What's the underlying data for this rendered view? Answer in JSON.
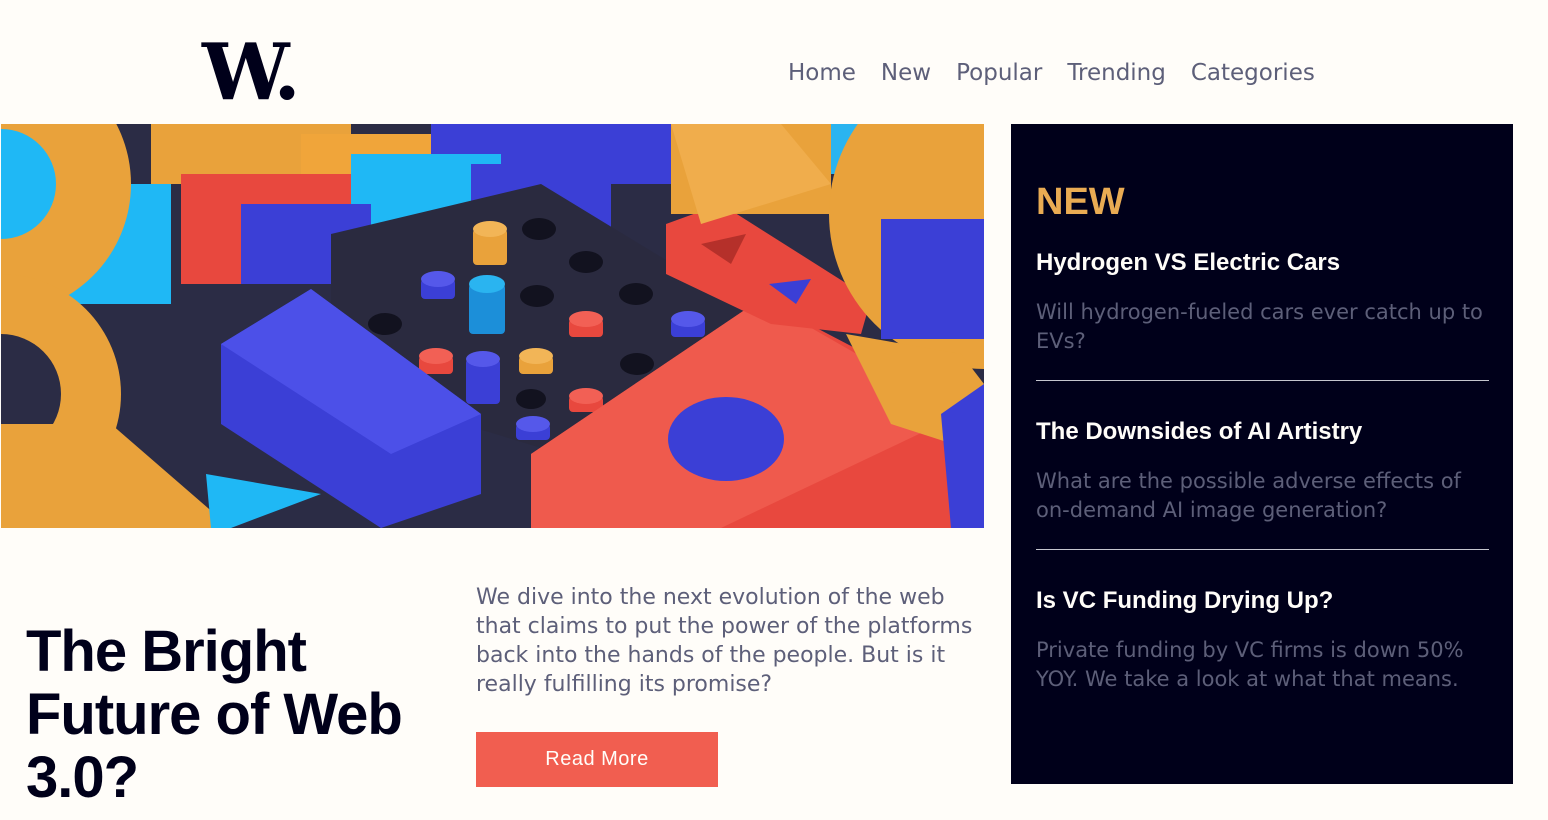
{
  "brand": {
    "logo_text": "W."
  },
  "nav": {
    "items": [
      "Home",
      "New",
      "Popular",
      "Trending",
      "Categories"
    ]
  },
  "hero": {
    "image_alt": "hero-illustration",
    "headline": "The Bright Future of Web 3.0?",
    "description": "We dive into the next evolution of the web that claims to put the power of the platforms back into the hands of the people. But is it really fulfilling its promise?",
    "cta_label": "Read More"
  },
  "new_panel": {
    "heading": "NEW",
    "items": [
      {
        "title": "Hydrogen VS Electric Cars",
        "summary": "Will hydrogen-fueled cars ever catch up to EVs?"
      },
      {
        "title": "The Downsides of AI Artistry",
        "summary": "What are the possible adverse effects of on-demand AI image generation?"
      },
      {
        "title": "Is VC Funding Drying Up?",
        "summary": "Private funding by VC firms is down 50% YOY. We take a look at what that means."
      }
    ]
  },
  "colors": {
    "background": "#fffdf9",
    "dark_navy": "#00001a",
    "accent_orange": "#e9ab53",
    "accent_red": "#f15e50",
    "grayish_blue": "#5d5f79"
  }
}
